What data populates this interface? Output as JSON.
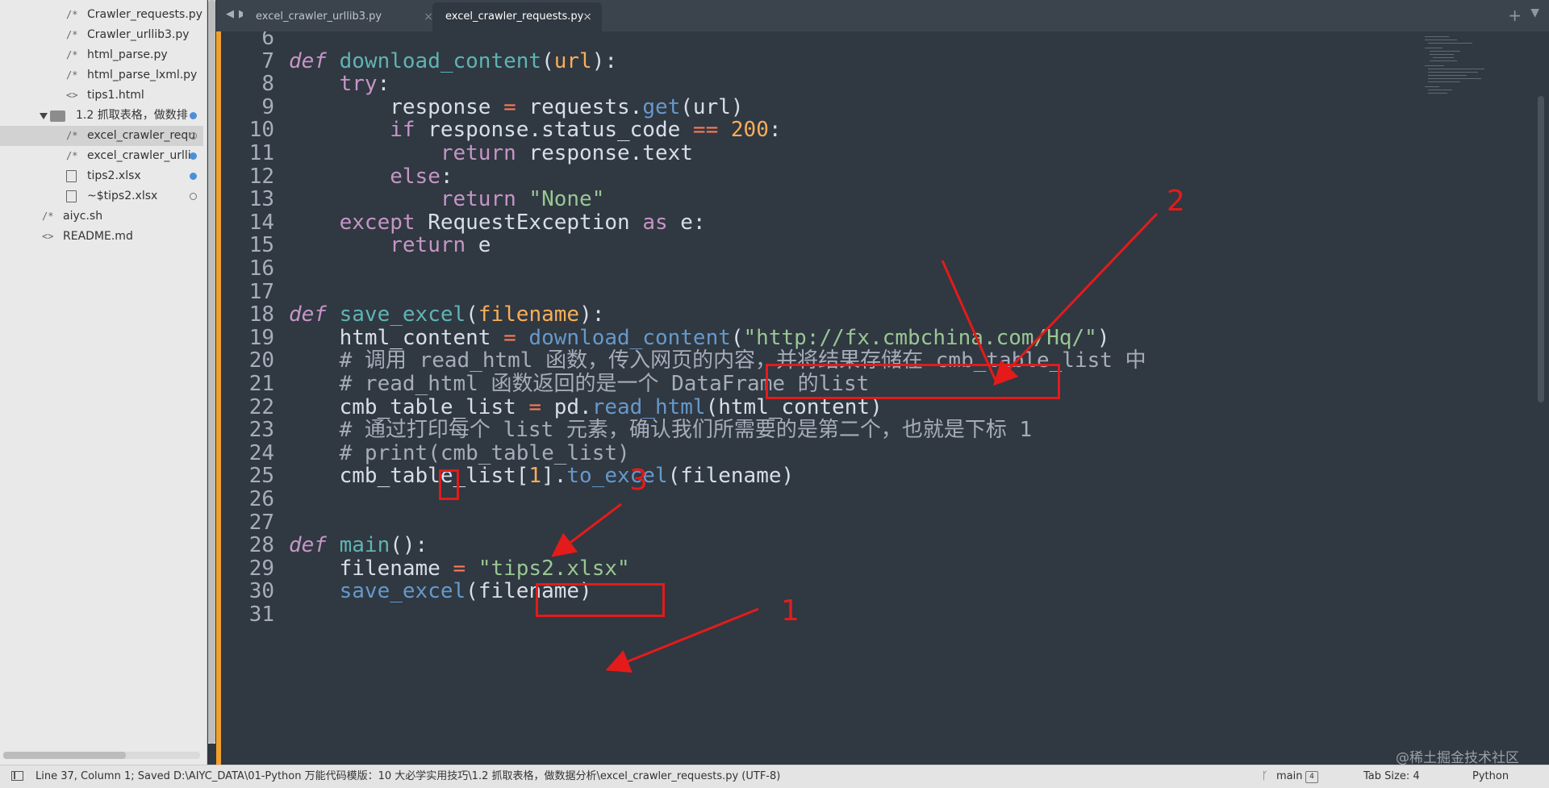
{
  "sidebar": {
    "items": [
      {
        "icon": "code-file-icon",
        "glyph": "/*",
        "label": "Crawler_requests.py",
        "dot": ""
      },
      {
        "icon": "code-file-icon",
        "glyph": "/*",
        "label": "Crawler_urllib3.py",
        "dot": ""
      },
      {
        "icon": "code-file-icon",
        "glyph": "/*",
        "label": "html_parse.py",
        "dot": ""
      },
      {
        "icon": "code-file-icon",
        "glyph": "/*",
        "label": "html_parse_lxml.py",
        "dot": ""
      },
      {
        "icon": "markup-file-icon",
        "glyph": "<>",
        "label": "tips1.html",
        "dot": ""
      },
      {
        "icon": "folder-icon",
        "glyph": "",
        "label": "1.2 抓取表格，做数排",
        "dot": "filled"
      },
      {
        "icon": "code-file-icon",
        "glyph": "/*",
        "label": "excel_crawler_requ",
        "dot": "hollow"
      },
      {
        "icon": "code-file-icon",
        "glyph": "/*",
        "label": "excel_crawler_urlli",
        "dot": "filled"
      },
      {
        "icon": "file-icon",
        "glyph": "",
        "label": "tips2.xlsx",
        "dot": "filled"
      },
      {
        "icon": "file-icon",
        "glyph": "",
        "label": "~$tips2.xlsx",
        "dot": "hollow"
      },
      {
        "icon": "code-file-icon",
        "glyph": "/*",
        "label": "aiyc.sh",
        "dot": ""
      },
      {
        "icon": "markup-file-icon",
        "glyph": "<>",
        "label": "README.md",
        "dot": ""
      }
    ]
  },
  "tabs": {
    "back": "◀",
    "forward": "▶",
    "items": [
      {
        "label": "excel_crawler_urllib3.py",
        "close": "×"
      },
      {
        "label": "excel_crawler_requests.py",
        "close": "×"
      }
    ],
    "new_tab": "+",
    "menu": "▼"
  },
  "editor": {
    "accent_color": "#f2a02c",
    "lines": [
      {
        "n": "6",
        "html": ""
      },
      {
        "n": "7",
        "html": "<span class='kwi'>def</span> <span class='fnd'>download_content</span>(<span class='pa'>url</span>):"
      },
      {
        "n": "8",
        "html": "    <span class='kw'>try</span>:"
      },
      {
        "n": "9",
        "html": "        response <span class='op'>=</span> requests.<span class='fn'>get</span>(url)"
      },
      {
        "n": "10",
        "html": "        <span class='kw'>if</span> response.status_code <span class='op'>==</span> <span class='nu'>200</span>:"
      },
      {
        "n": "11",
        "html": "            <span class='kw'>return</span> response.text"
      },
      {
        "n": "12",
        "html": "        <span class='kw'>else</span>:"
      },
      {
        "n": "13",
        "html": "            <span class='kw'>return</span> <span class='st'>\"None\"</span>"
      },
      {
        "n": "14",
        "html": "    <span class='kw'>except</span> RequestException <span class='kw'>as</span> e:"
      },
      {
        "n": "15",
        "html": "        <span class='kw'>return</span> e"
      },
      {
        "n": "16",
        "html": ""
      },
      {
        "n": "17",
        "html": ""
      },
      {
        "n": "18",
        "html": "<span class='kwi'>def</span> <span class='fnd'>save_excel</span>(<span class='pa'>filename</span>):"
      },
      {
        "n": "19",
        "html": "    html_content <span class='op'>=</span> <span class='fn'>download_content</span>(<span class='st'>\"http://fx.cmbchina.com/Hq/\"</span>)"
      },
      {
        "n": "20",
        "html": "    <span class='cm'># 调用 read_html 函数，传入网页的内容，并将结果存储在 cmb_table_list 中</span>"
      },
      {
        "n": "21",
        "html": "    <span class='cm'># read_html 函数返回的是一个 DataFrame 的list</span>"
      },
      {
        "n": "22",
        "html": "    cmb_table_list <span class='op'>=</span> pd.<span class='fn'>read_html</span>(html_content)"
      },
      {
        "n": "23",
        "html": "    <span class='cm'># 通过打印每个 list 元素，确认我们所需要的是第二个，也就是下标 1</span>"
      },
      {
        "n": "24",
        "html": "    <span class='cm'># print(cmb_table_list)</span>"
      },
      {
        "n": "25",
        "html": "    cmb_table_list[<span class='nu'>1</span>].<span class='fn'>to_excel</span>(filename)"
      },
      {
        "n": "26",
        "html": ""
      },
      {
        "n": "27",
        "html": ""
      },
      {
        "n": "28",
        "html": "<span class='kwi'>def</span> <span class='fnd'>main</span>():"
      },
      {
        "n": "29",
        "html": "    filename <span class='op'>=</span> <span class='st'>\"tips2.xlsx\"</span>"
      },
      {
        "n": "30",
        "html": "    <span class='fn'>save_excel</span>(filename)"
      },
      {
        "n": "31",
        "html": ""
      }
    ]
  },
  "annotations": {
    "color": "#e31b1b",
    "labels": [
      "2",
      "3",
      "1"
    ]
  },
  "statusbar": {
    "text": "Line 37, Column 1; Saved D:\\AIYC_DATA\\01-Python 万能代码模版：10 大必学实用技巧\\1.2 抓取表格，做数据分析\\excel_crawler_requests.py (UTF-8)",
    "branch_icon": "branch-icon",
    "branch": "main",
    "branch_count": "4",
    "tab_size": "Tab Size: 4",
    "syntax": "Python"
  },
  "watermark": "@稀土掘金技术社区"
}
